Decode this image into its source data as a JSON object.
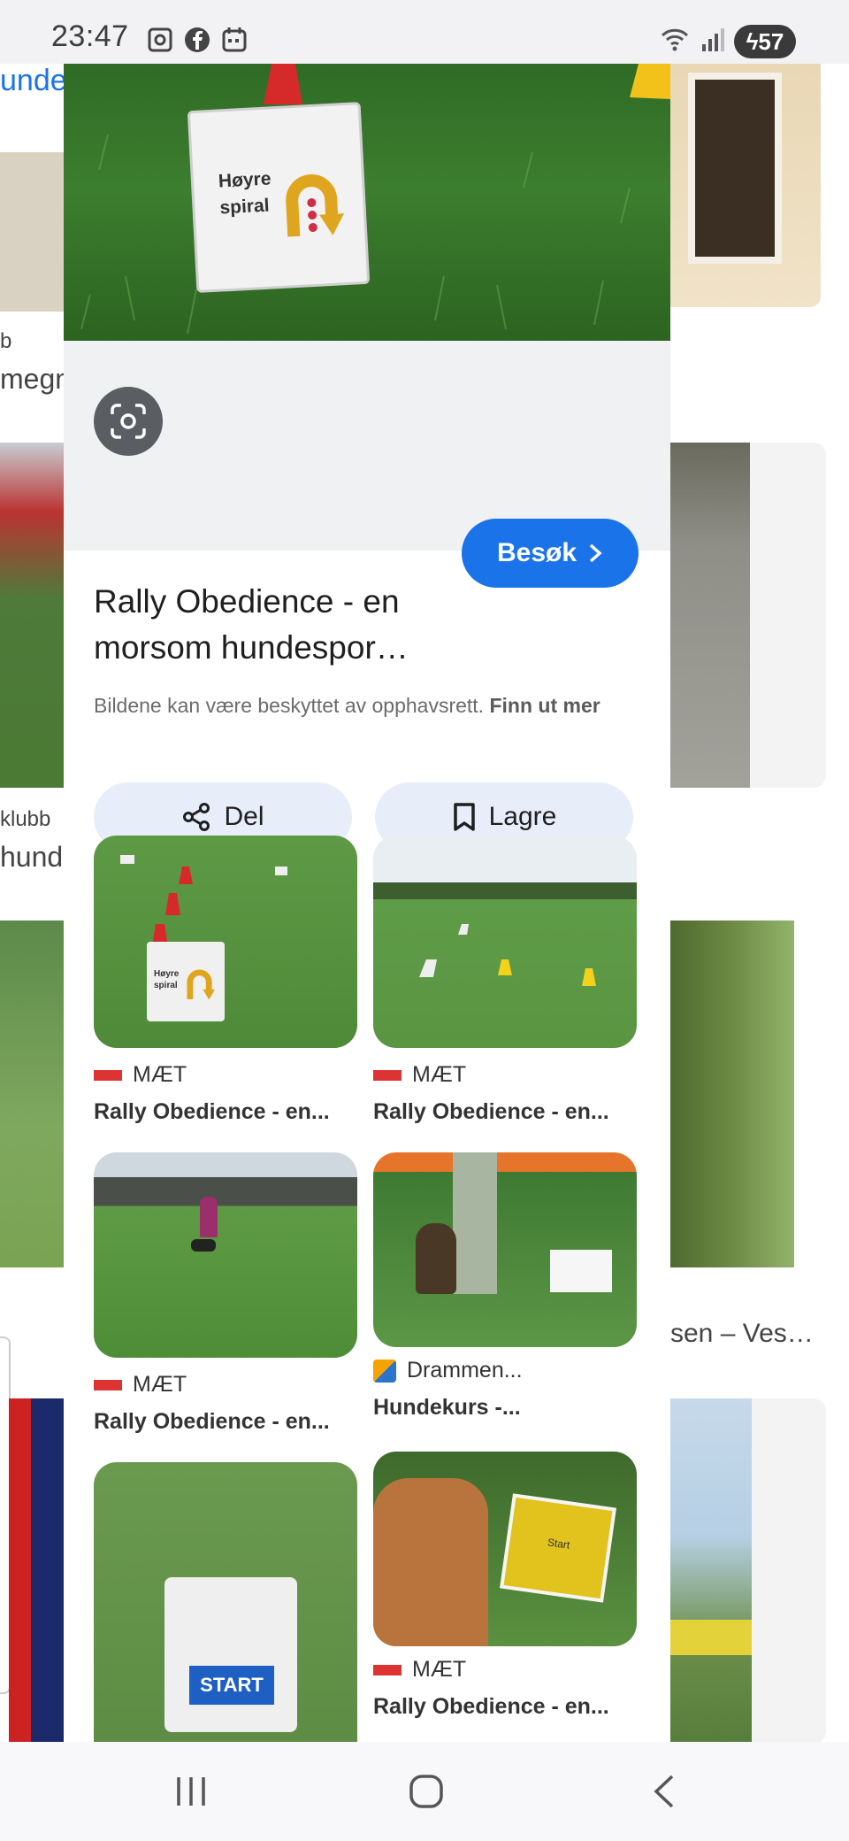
{
  "status_bar": {
    "time": "23:47",
    "battery": "57"
  },
  "background_page": {
    "fragments": [
      "unde",
      "b",
      "megn",
      "klubb",
      "hund",
      "sen – Ves…"
    ]
  },
  "sheet": {
    "hero_sign_text": "Høyre spiral",
    "title": "Rally Obedience - en morsom hundespor…",
    "visit_label": "Besøk",
    "copyright_notice": "Bildene kan være beskyttet av opphavsrett.",
    "learn_more": "Finn ut mer",
    "share_label": "Del",
    "save_label": "Lagre",
    "related": [
      {
        "source": "MÆT",
        "caption": "Rally Obedience - en..."
      },
      {
        "source": "MÆT",
        "caption": "Rally Obedience - en..."
      },
      {
        "source": "MÆT",
        "caption": "Rally Obedience - en..."
      },
      {
        "source": "Drammen...",
        "caption": "Hundekurs -..."
      },
      {
        "source": "",
        "caption": ""
      },
      {
        "source": "MÆT",
        "caption": "Rally Obedience - en..."
      }
    ],
    "thumb_sign_texts": {
      "t1": "Høyre spiral",
      "t5": "START",
      "t6": "Start"
    }
  },
  "colors": {
    "accent": "#1a73e8",
    "pill_bg": "#e8eef9",
    "source_logo": "#dd3333"
  }
}
